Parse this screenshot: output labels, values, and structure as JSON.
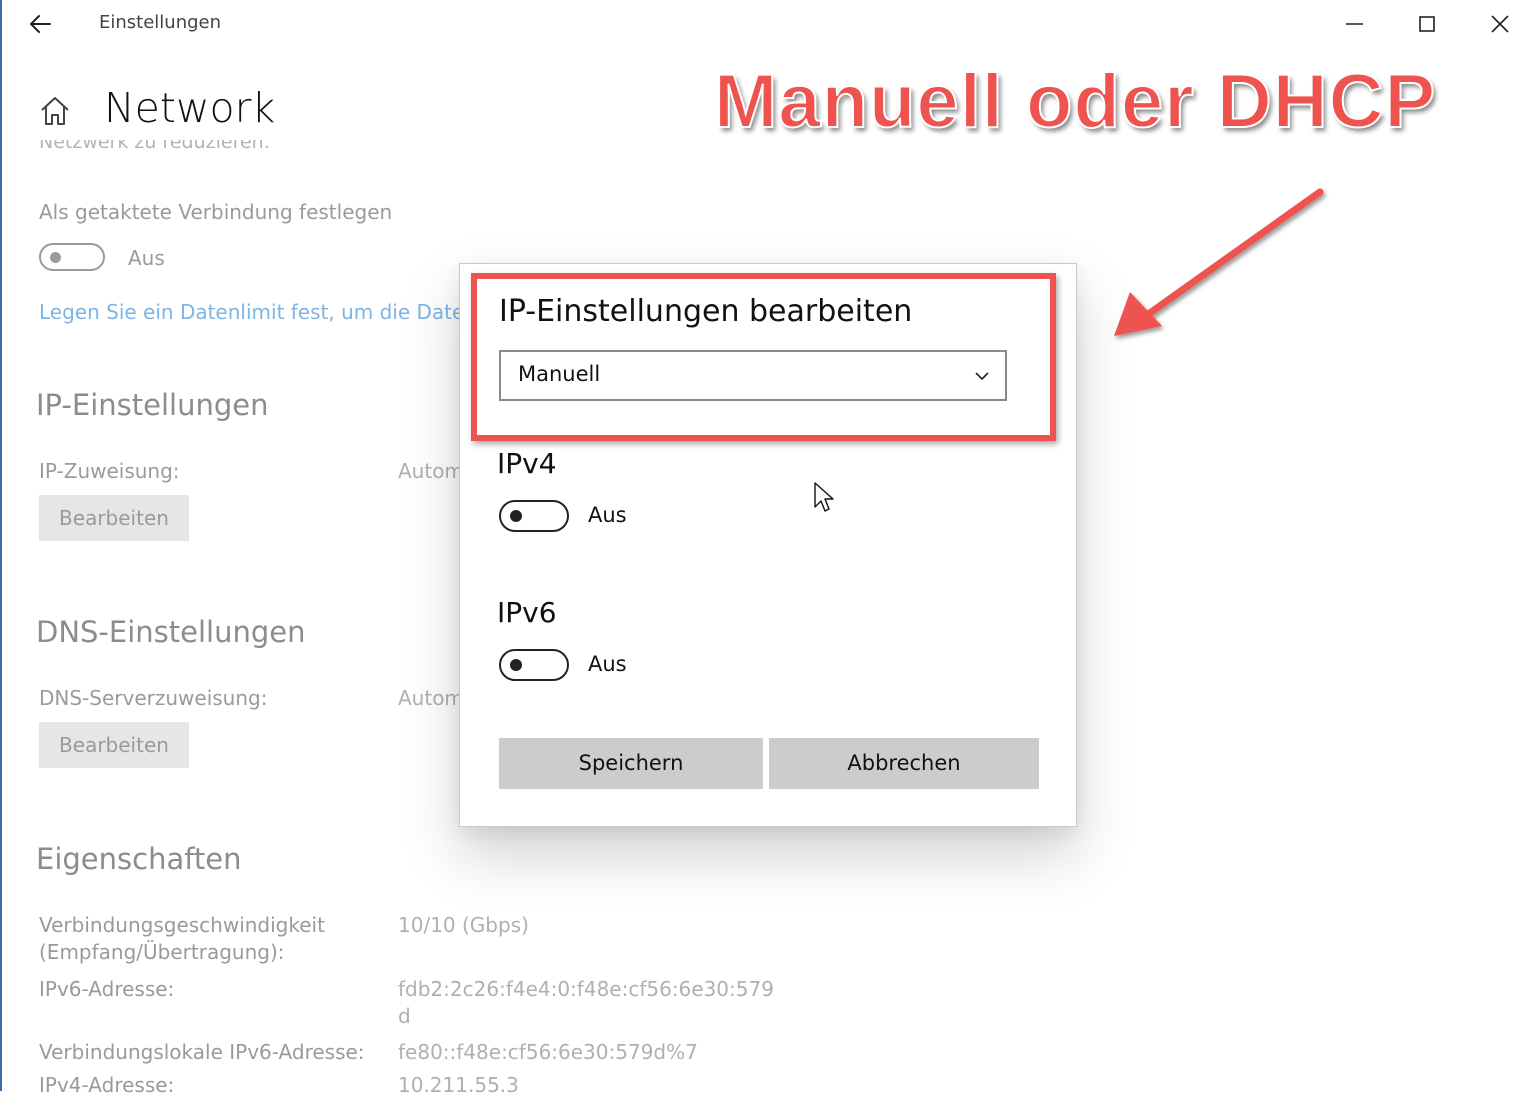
{
  "window": {
    "title": "Einstellungen",
    "controls": [
      "minimize",
      "maximize",
      "close"
    ]
  },
  "page": {
    "title": "Network",
    "cut_text": "Netzwerk zu reduzieren.",
    "metered": {
      "label": "Als getaktete Verbindung festlegen",
      "toggle_state": "Aus"
    },
    "data_limit_link": "Legen Sie ein Datenlimit fest, um die Daten",
    "ip_settings": {
      "heading": "IP-Einstellungen",
      "assignment_label": "IP-Zuweisung:",
      "assignment_value": "Autom",
      "edit_button": "Bearbeiten"
    },
    "dns_settings": {
      "heading": "DNS-Einstellungen",
      "assignment_label": "DNS-Serverzuweisung:",
      "assignment_value": "Autom",
      "edit_button": "Bearbeiten"
    },
    "properties": {
      "heading": "Eigenschaften",
      "rows": [
        {
          "label1": "Verbindungsgeschwindigkeit",
          "label2": "(Empfang/Übertragung):",
          "value1": "10/10 (Gbps)",
          "value2": ""
        },
        {
          "label1": "IPv6-Adresse:",
          "label2": "",
          "value1": "fdb2:2c26:f4e4:0:f48e:cf56:6e30:579",
          "value2": "d"
        },
        {
          "label1": "Verbindungslokale IPv6-Adresse:",
          "label2": "",
          "value1": "fe80::f48e:cf56:6e30:579d%7",
          "value2": ""
        },
        {
          "label1": "IPv4-Adresse:",
          "label2": "",
          "value1": "10.211.55.3",
          "value2": ""
        }
      ]
    }
  },
  "dialog": {
    "title": "IP-Einstellungen bearbeiten",
    "mode_select": {
      "value": "Manuell"
    },
    "ipv4": {
      "label": "IPv4",
      "toggle_state": "Aus"
    },
    "ipv6": {
      "label": "IPv6",
      "toggle_state": "Aus"
    },
    "save_button": "Speichern",
    "cancel_button": "Abbrechen"
  },
  "annotation": {
    "text": "Manuell oder DHCP",
    "color": "#ef5350"
  },
  "icons": [
    "back-arrow-icon",
    "home-icon",
    "minimize-icon",
    "maximize-icon",
    "close-icon",
    "chevron-down-icon",
    "mouse-pointer-icon",
    "annotation-arrow-icon"
  ]
}
